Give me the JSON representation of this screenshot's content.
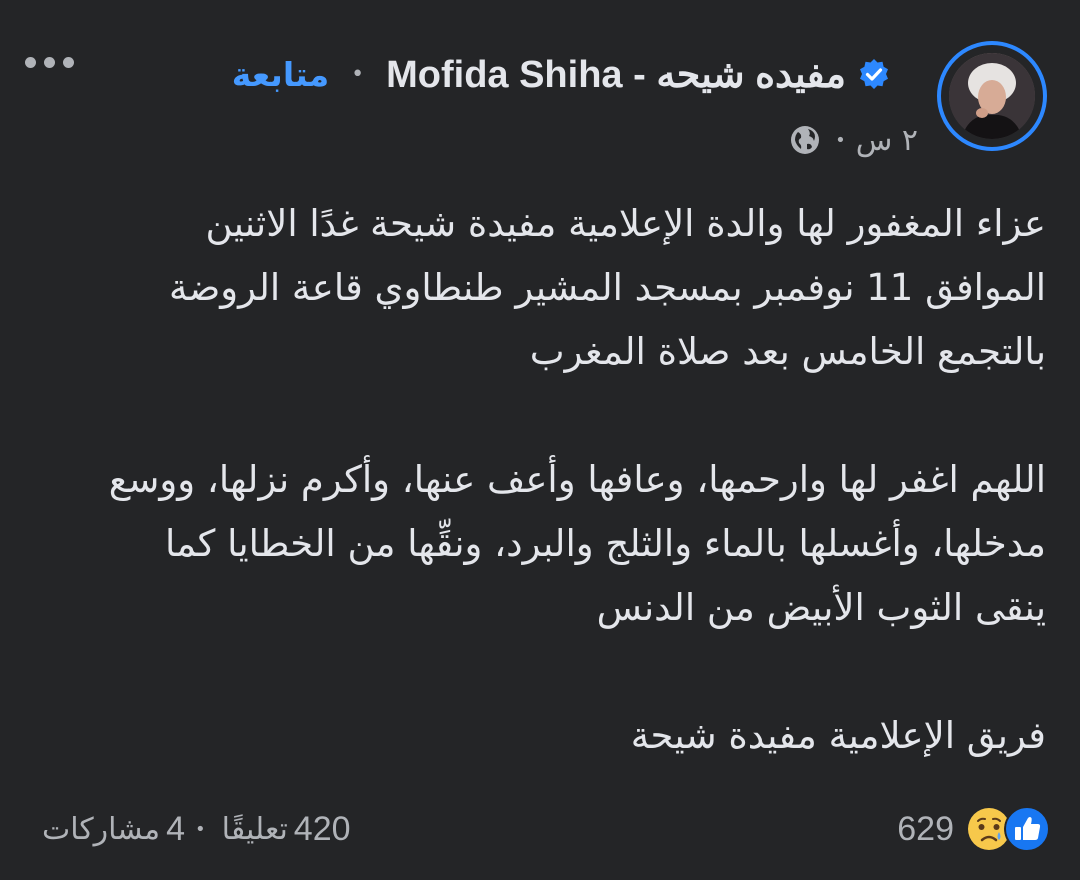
{
  "post": {
    "author": "Mofida Shiha - مفيده شيحه",
    "follow_label": "متابعة",
    "time": "٢ س",
    "privacy_icon": "globe-icon",
    "verified_icon": "verified-badge-icon",
    "body": {
      "paragraph1": [
        "عزاء المغفور لها والدة الإعلامية مفيدة شيحة غدًا الاثنين",
        "الموافق 11 نوفمبر بمسجد المشير طنطاوي قاعة الروضة",
        "بالتجمع الخامس بعد صلاة المغرب"
      ],
      "paragraph2": [
        "اللهم اغفر لها وارحمها، وعافها وأعف عنها، وأكرم نزلها، ووسع",
        "مدخلها، وأغسلها بالماء والثلج والبرد، ونقِّها من الخطايا كما",
        "ينقى الثوب الأبيض من الدنس"
      ],
      "paragraph3": [
        "فريق الإعلامية مفيدة شيحة"
      ]
    }
  },
  "reactions": {
    "count": "629",
    "types": [
      "like",
      "sad"
    ]
  },
  "stats": {
    "comments_count": "420",
    "comments_label": "تعليقًا",
    "shares_count": "4",
    "shares_label": "مشاركات"
  },
  "colors": {
    "background": "#242527",
    "text": "#e4e6eb",
    "secondary": "#b0b3b8",
    "accent": "#4599ff",
    "avatar_ring": "#2d88ff"
  }
}
